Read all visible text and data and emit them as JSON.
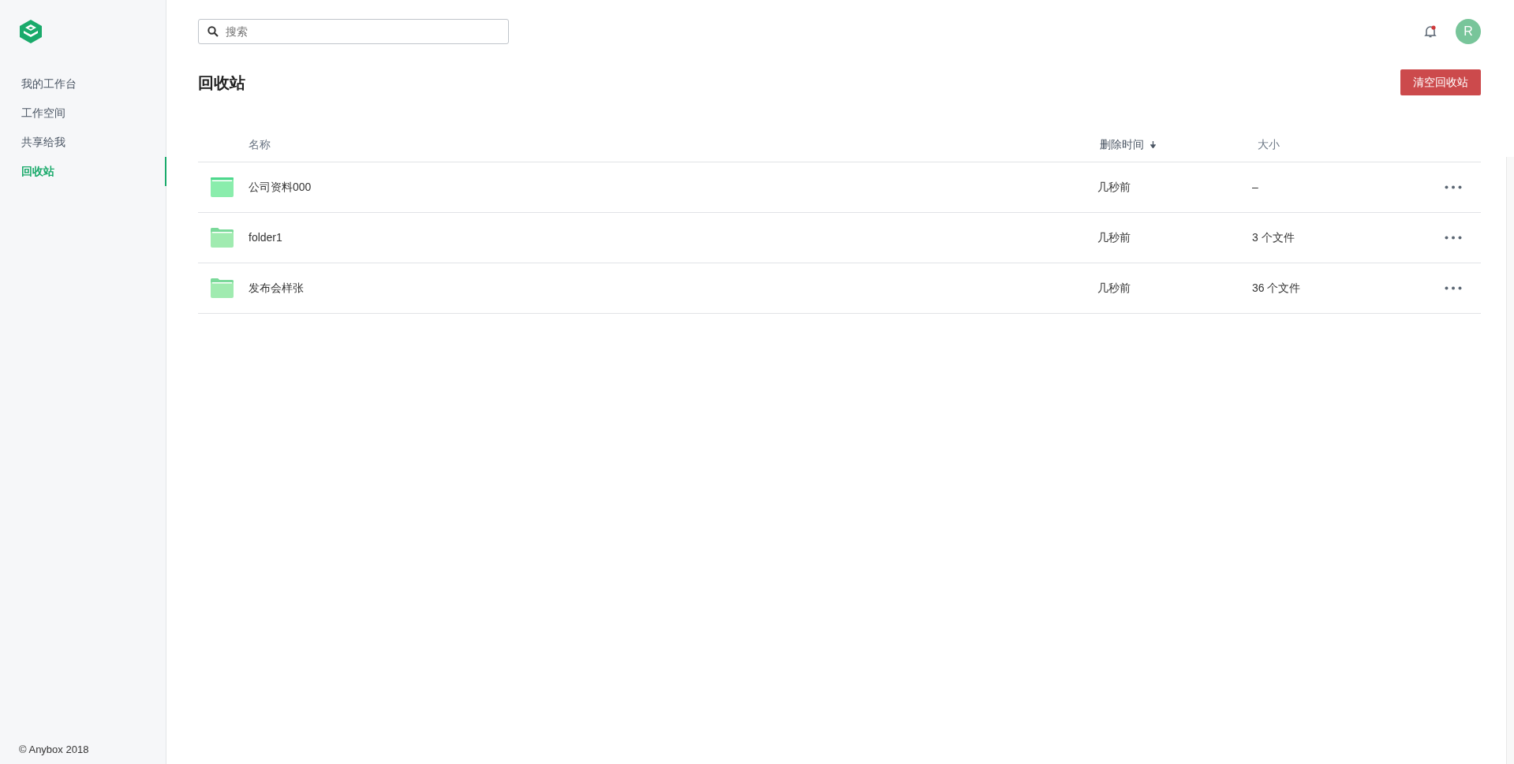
{
  "sidebar": {
    "items": [
      {
        "label": "我的工作台",
        "selected": false
      },
      {
        "label": "工作空间",
        "selected": false
      },
      {
        "label": "共享给我",
        "selected": false
      },
      {
        "label": "回收站",
        "selected": true
      }
    ],
    "footer": "© Anybox 2018"
  },
  "search": {
    "placeholder": "搜索"
  },
  "header": {
    "notifications_unread": true,
    "avatar": "R"
  },
  "page": {
    "title": "回收站",
    "action": "清空回收站"
  },
  "table": {
    "columns": [
      {
        "label": "名称",
        "sorted": false
      },
      {
        "label": "删除时间",
        "sorted": true
      },
      {
        "label": "大小",
        "sorted": false
      }
    ],
    "rows": [
      {
        "kind": "flat-folder",
        "name": "公司资料000",
        "deleted": "几秒前",
        "size": "–"
      },
      {
        "kind": "folder",
        "name": "folder1",
        "deleted": "几秒前",
        "size": "3 个文件"
      },
      {
        "kind": "folder",
        "name": "发布会样张",
        "deleted": "几秒前",
        "size": "36 个文件"
      }
    ]
  }
}
